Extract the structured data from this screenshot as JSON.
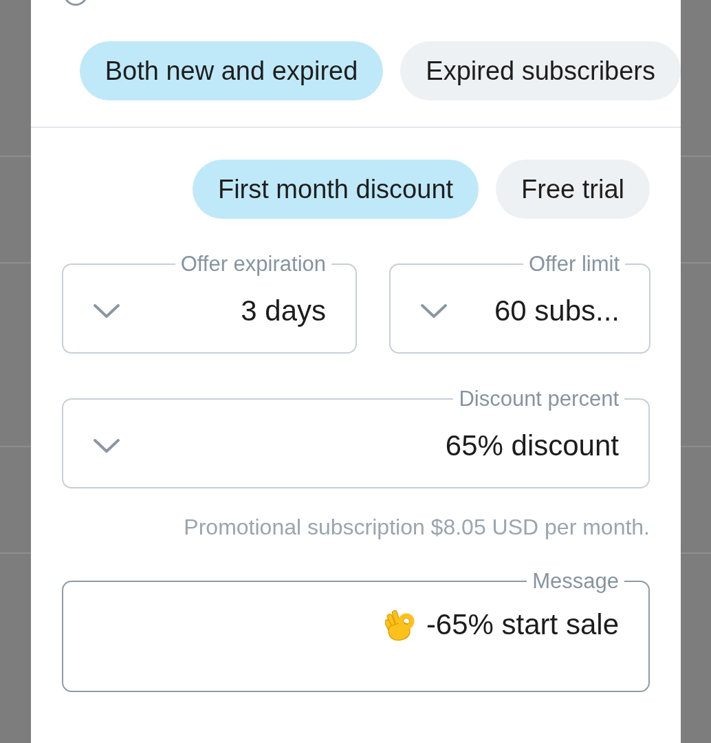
{
  "audience_chips": [
    {
      "label": "Both new and expired",
      "selected": true
    },
    {
      "label": "Expired subscribers",
      "selected": false
    }
  ],
  "offer_type_chips": [
    {
      "label": "First month discount",
      "selected": true
    },
    {
      "label": "Free trial",
      "selected": false
    }
  ],
  "fields": [
    {
      "label": "Offer expiration",
      "value": "3 days",
      "focused": false
    },
    {
      "label": "Offer limit",
      "value": "60 subs...",
      "focused": false
    }
  ],
  "discount": {
    "label": "Discount percent",
    "value": "65% discount",
    "focused": false
  },
  "helper_text": "Promotional subscription $8.05 USD per month.",
  "message": {
    "label": "Message",
    "value": "-65% start sale",
    "focused": true
  }
}
